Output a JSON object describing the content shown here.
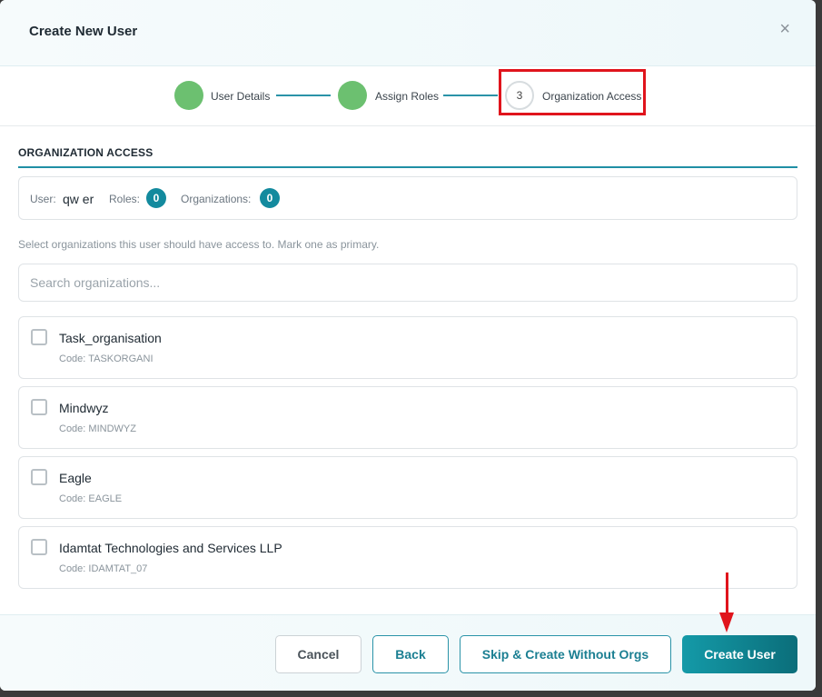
{
  "modal": {
    "title": "Create New User",
    "close_glyph": "×"
  },
  "stepper": {
    "steps": [
      {
        "label": "User Details",
        "state": "done"
      },
      {
        "label": "Assign Roles",
        "state": "done"
      },
      {
        "label": "Organization Access",
        "state": "current",
        "number": "3"
      }
    ],
    "accent_color": "#2a93a8",
    "done_color": "#6cc070"
  },
  "section": {
    "title": "ORGANIZATION ACCESS",
    "summary": {
      "user_label": "User:",
      "user_value": "qw er",
      "roles_label": "Roles:",
      "roles_count": "0",
      "orgs_label": "Organizations:",
      "orgs_count": "0"
    },
    "helper_text": "Select organizations this user should have access to. Mark one as primary.",
    "search_placeholder": "Search organizations..."
  },
  "organizations": [
    {
      "name": "Task_organisation",
      "code": "Code: TASKORGANI",
      "checked": false
    },
    {
      "name": "Mindwyz",
      "code": "Code: MINDWYZ",
      "checked": false
    },
    {
      "name": "Eagle",
      "code": "Code: EAGLE",
      "checked": false
    },
    {
      "name": "Idamtat Technologies and Services LLP",
      "code": "Code: IDAMTAT_07",
      "checked": false
    }
  ],
  "footer": {
    "cancel_label": "Cancel",
    "back_label": "Back",
    "skip_label": "Skip & Create Without Orgs",
    "create_label": "Create User"
  },
  "annotations": {
    "highlight_color": "#e0141c"
  }
}
